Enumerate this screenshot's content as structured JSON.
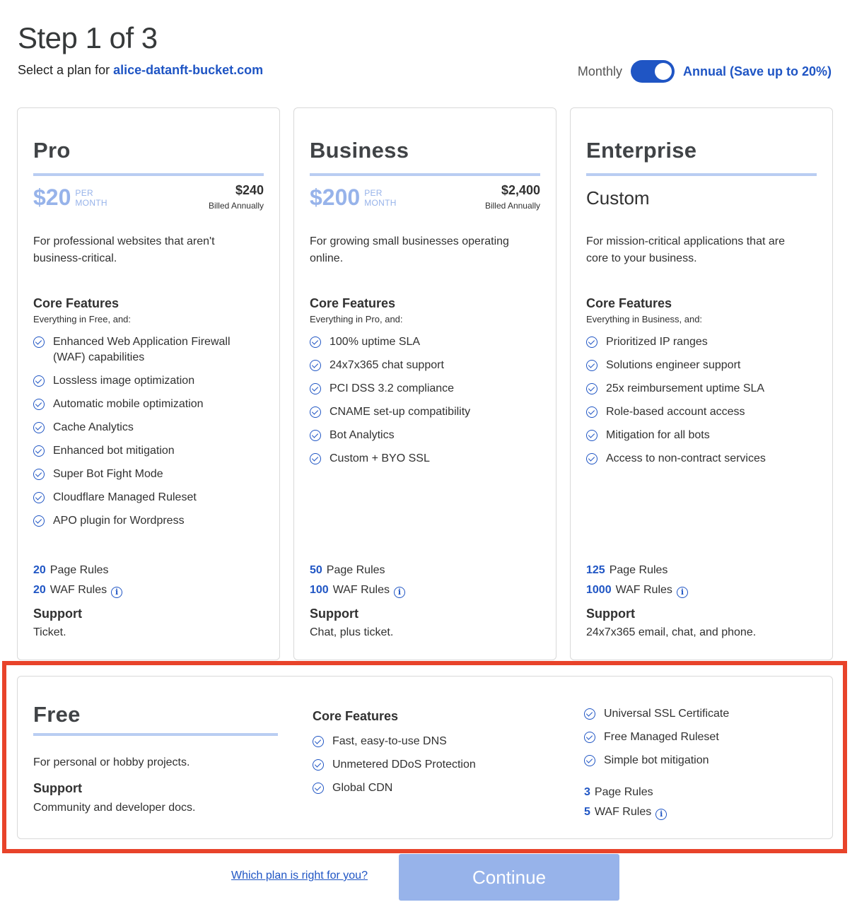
{
  "header": {
    "step_title": "Step 1 of 3",
    "subtitle_prefix": "Select a plan for",
    "domain": "alice-datanft-bucket.com"
  },
  "billing_toggle": {
    "monthly_label": "Monthly",
    "annual_label": "Annual (Save up to 20%)",
    "selected": "annual"
  },
  "plans": {
    "pro": {
      "name": "Pro",
      "price": "$20",
      "per": "PER",
      "period": "MONTH",
      "annual_total": "$240",
      "billed": "Billed Annually",
      "description": "For professional websites that aren't business-critical.",
      "core_title": "Core Features",
      "core_sub": "Everything in Free, and:",
      "features": [
        "Enhanced Web Application Firewall (WAF) capabilities",
        "Lossless image optimization",
        "Automatic mobile optimization",
        "Cache Analytics",
        "Enhanced bot mitigation",
        "Super Bot Fight Mode",
        "Cloudflare Managed Ruleset",
        "APO plugin for Wordpress"
      ],
      "page_rules_num": "20",
      "page_rules_label": "Page Rules",
      "waf_rules_num": "20",
      "waf_rules_label": "WAF Rules",
      "support_title": "Support",
      "support_text": "Ticket."
    },
    "business": {
      "name": "Business",
      "price": "$200",
      "per": "PER",
      "period": "MONTH",
      "annual_total": "$2,400",
      "billed": "Billed Annually",
      "description": "For growing small businesses operating online.",
      "core_title": "Core Features",
      "core_sub": "Everything in Pro, and:",
      "features": [
        "100% uptime SLA",
        "24x7x365 chat support",
        "PCI DSS 3.2 compliance",
        "CNAME set-up compatibility",
        "Bot Analytics",
        "Custom + BYO SSL"
      ],
      "page_rules_num": "50",
      "page_rules_label": "Page Rules",
      "waf_rules_num": "100",
      "waf_rules_label": "WAF Rules",
      "support_title": "Support",
      "support_text": "Chat, plus ticket."
    },
    "enterprise": {
      "name": "Enterprise",
      "price_text": "Custom",
      "description": "For mission-critical applications that are core to your business.",
      "core_title": "Core Features",
      "core_sub": "Everything in Business, and:",
      "features": [
        "Prioritized IP ranges",
        "Solutions engineer support",
        "25x reimbursement uptime SLA",
        "Role-based account access",
        "Mitigation for all bots",
        "Access to non-contract services"
      ],
      "page_rules_num": "125",
      "page_rules_label": "Page Rules",
      "waf_rules_num": "1000",
      "waf_rules_label": "WAF Rules",
      "support_title": "Support",
      "support_text": "24x7x365 email, chat, and phone."
    },
    "free": {
      "name": "Free",
      "description": "For personal or hobby projects.",
      "support_title": "Support",
      "support_text": "Community and developer docs.",
      "core_title": "Core Features",
      "features_a": [
        "Fast, easy-to-use DNS",
        "Unmetered DDoS Protection",
        "Global CDN"
      ],
      "features_b": [
        "Universal SSL Certificate",
        "Free Managed Ruleset",
        "Simple bot mitigation"
      ],
      "page_rules_num": "3",
      "page_rules_label": "Page Rules",
      "waf_rules_num": "5",
      "waf_rules_label": "WAF Rules"
    }
  },
  "footer": {
    "help_link": "Which plan is right for you?",
    "continue_label": "Continue"
  },
  "icons": {
    "check": "check-circle-icon",
    "info": "info-circle-icon"
  },
  "colors": {
    "accent": "#1f55c4",
    "accent_light": "#97b3ea",
    "rule": "#b9cdf2",
    "highlight": "#e8432a"
  }
}
